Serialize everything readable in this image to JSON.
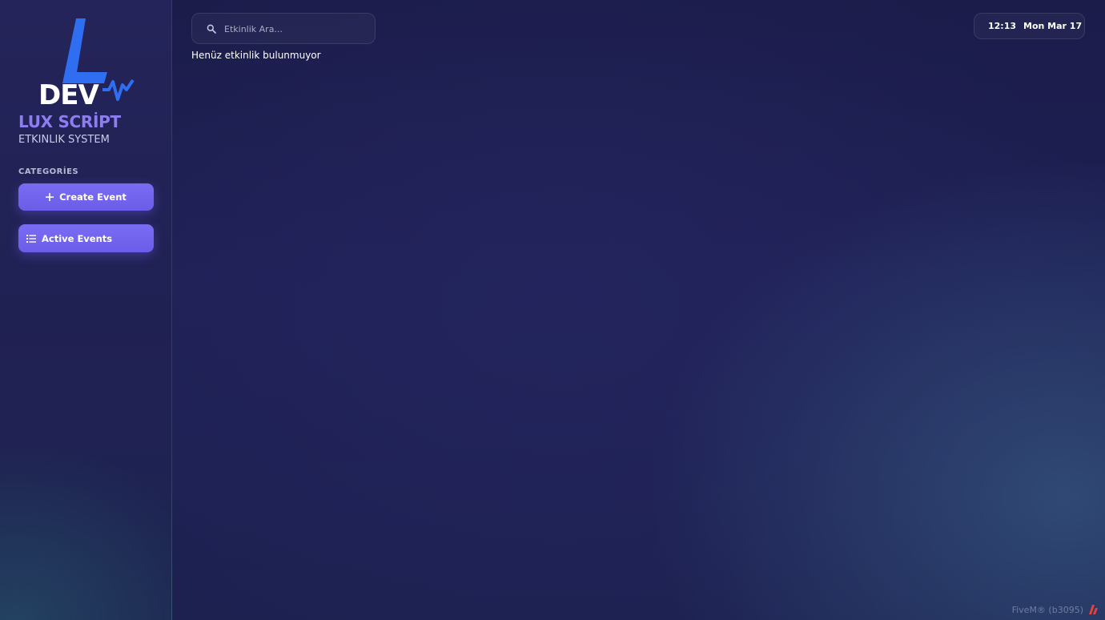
{
  "sidebar": {
    "logo_text": "DEV",
    "brand_title": "LUX SCRİPT",
    "brand_subtitle": "ETKINLIK SYSTEM",
    "categories_label": "CATEGORİES",
    "items": [
      {
        "label": "Create Event",
        "icon": "plus-icon"
      },
      {
        "label": "Active Events",
        "icon": "list-icon"
      }
    ]
  },
  "search": {
    "placeholder": "Etkinlik Ara...",
    "value": "",
    "icon": "search-icon"
  },
  "main": {
    "empty_message": "Henüz etkinlik bulunmuyor"
  },
  "clock": {
    "time": "12:13",
    "date": "Mon Mar 17"
  },
  "footer": {
    "fivem_label": "FiveM® (b3095)",
    "icon": "fivem-logo-icon"
  },
  "colors": {
    "accent": "#7a6cf2",
    "brand_title": "#8e7df0",
    "background": "#1e2055",
    "logo_blue": "#2f6ef0"
  }
}
